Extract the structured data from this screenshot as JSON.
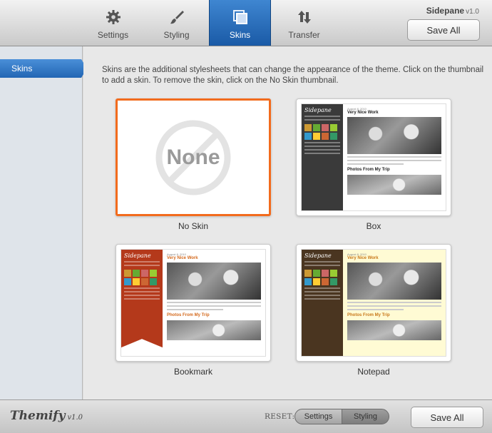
{
  "toolbar": {
    "tabs": [
      {
        "label": "Settings",
        "icon": "gear-icon"
      },
      {
        "label": "Styling",
        "icon": "brush-icon"
      },
      {
        "label": "Skins",
        "icon": "skins-icon"
      },
      {
        "label": "Transfer",
        "icon": "transfer-icon"
      }
    ],
    "active_tab": "Skins",
    "brand": "Sidepane",
    "version": "v1.0",
    "save_label": "Save All"
  },
  "sidebar": {
    "items": [
      {
        "label": "Skins"
      }
    ]
  },
  "main": {
    "description": "Skins are the additional stylesheets that can change the appearance of the theme. Click on the thumbnail to add a skin. To remove the skin, click on the No Skin thumbnail.",
    "skins": [
      {
        "label": "No Skin",
        "thumb_text": "None",
        "selected": true
      },
      {
        "label": "Box",
        "sidebar_color": "#3a3a3a",
        "body_color": "#ffffff"
      },
      {
        "label": "Bookmark",
        "sidebar_color": "#b4391b",
        "body_color": "#ffffff"
      },
      {
        "label": "Notepad",
        "sidebar_color": "#4a3520",
        "body_color": "#fffbd4"
      }
    ],
    "mini_theme": {
      "title": "Sidepane",
      "post1_date": "August 8, 2010",
      "post1_title": "Very Nice Work",
      "post2_title": "Photos From My Trip"
    }
  },
  "footer": {
    "logo": "Themify",
    "logo_version": "v1.0",
    "reset_label": "RESET:",
    "reset_options": [
      "Settings",
      "Styling"
    ],
    "save_label": "Save All"
  },
  "colors": {
    "accent": "#2a6cbf",
    "selected_border": "#f26b1d"
  }
}
